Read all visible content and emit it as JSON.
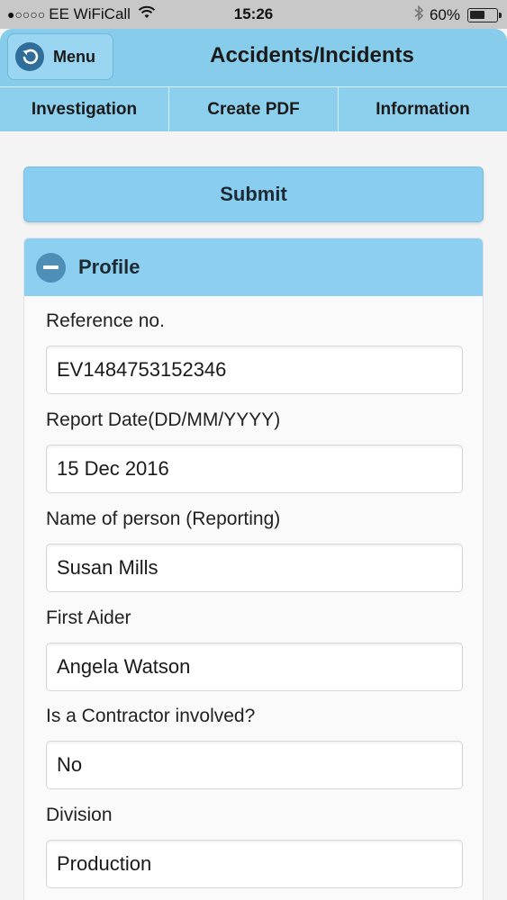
{
  "status_bar": {
    "signal": "●○○○○",
    "carrier": "EE WiFiCall",
    "time": "15:26",
    "battery_percent": "60%",
    "battery_level": 0.6,
    "icons": [
      "wifi-icon",
      "bluetooth-icon",
      "battery-icon"
    ]
  },
  "header": {
    "menu_label": "Menu",
    "title": "Accidents/Incidents"
  },
  "tabs": [
    {
      "label": "Investigation"
    },
    {
      "label": "Create PDF"
    },
    {
      "label": "Information"
    }
  ],
  "submit_label": "Submit",
  "profile": {
    "title": "Profile",
    "fields": [
      {
        "label": "Reference no.",
        "value": "EV1484753152346"
      },
      {
        "label": "Report Date(DD/MM/YYYY)",
        "value": "15 Dec 2016"
      },
      {
        "label": "Name of person (Reporting)",
        "value": "Susan Mills"
      },
      {
        "label": "First Aider",
        "value": "Angela Watson"
      },
      {
        "label": "Is a Contractor involved?",
        "value": "No"
      },
      {
        "label": "Division",
        "value": "Production"
      }
    ]
  },
  "colors": {
    "header_bg": "#87cdeb",
    "accent_dark": "#2f6e9b",
    "section_bg": "#8dcff1"
  }
}
